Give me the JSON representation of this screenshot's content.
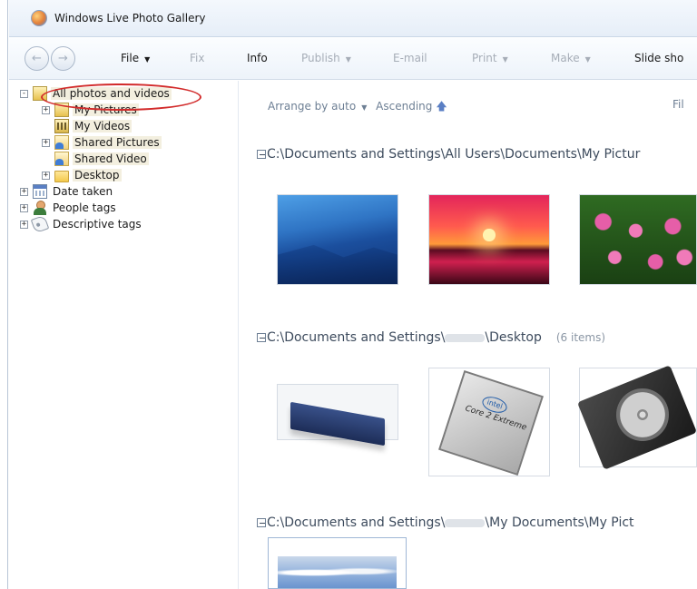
{
  "app": {
    "title": "Windows Live Photo Gallery"
  },
  "toolbar": {
    "file": "File",
    "fix": "Fix",
    "info": "Info",
    "publish": "Publish",
    "email": "E-mail",
    "print": "Print",
    "make": "Make",
    "slideshow": "Slide sho"
  },
  "tree": {
    "all_photos": "All photos and videos",
    "my_pictures": "My Pictures",
    "my_videos": "My Videos",
    "shared_pictures": "Shared Pictures",
    "shared_video": "Shared Video",
    "desktop": "Desktop",
    "date_taken": "Date taken",
    "people_tags": "People tags",
    "descriptive_tags": "Descriptive tags"
  },
  "view": {
    "arrange": "Arrange by auto",
    "order": "Ascending",
    "filter": "Fil"
  },
  "groups": [
    {
      "path": "C:\\Documents and Settings\\All Users\\Documents\\My Pictur"
    },
    {
      "path_start": "C:\\Documents and Settings\\",
      "path_end": "\\Desktop",
      "count": "(6 items)"
    },
    {
      "path_start": "C:\\Documents and Settings\\",
      "path_end": "\\My Documents\\My Pict"
    }
  ],
  "thumbs": {
    "cpu_brand": "intel"
  },
  "colors": {
    "selection_oval": "#d22b2b",
    "toolbar_bg": "#edf3fa",
    "highlight": "#f3efdf"
  }
}
